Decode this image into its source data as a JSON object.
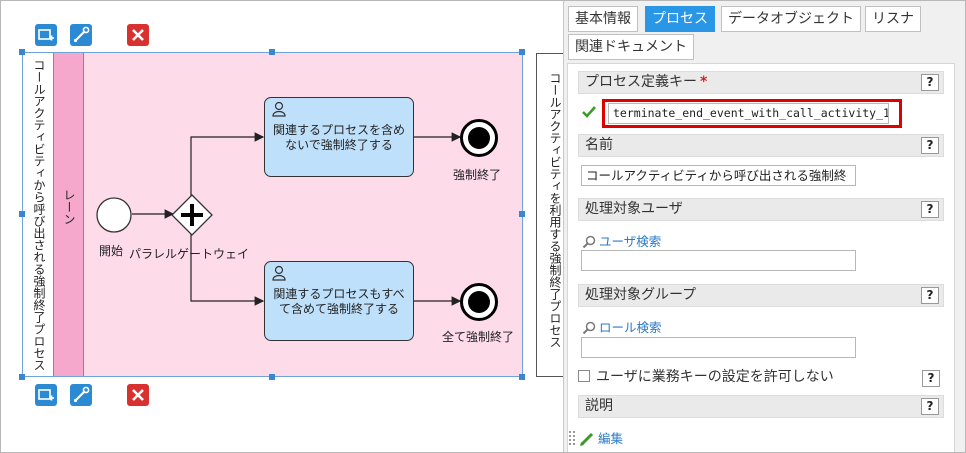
{
  "canvas": {
    "pool_label": "コールアクティビティから呼び出される強制終了プロセス",
    "lane_label": "レーン",
    "start_label": "開始",
    "gateway_label": "パラレルゲートウェイ",
    "task1_label": "関連するプロセスを含めないで強制終了する",
    "task2_label": "関連するプロセスもすべて含めて強制終了する",
    "end1_label": "強制終了",
    "end2_label": "全て強制終了",
    "other_pool_label": "コールアクティビティを利用する強制終了プロセス"
  },
  "tabs": [
    {
      "label": "基本情報",
      "active": false
    },
    {
      "label": "プロセス",
      "active": true
    },
    {
      "label": "データオブジェクト",
      "active": false
    },
    {
      "label": "リスナ",
      "active": false
    },
    {
      "label": "関連ドキュメント",
      "active": false
    }
  ],
  "properties": {
    "process_key": {
      "label": "プロセス定義キー",
      "required_mark": "*",
      "value": "terminate_end_event_with_call_activity_1"
    },
    "name": {
      "label": "名前",
      "value": "コールアクティビティから呼び出される強制終"
    },
    "assignee_user": {
      "label": "処理対象ユーザ",
      "link": "ユーザ検索",
      "value": ""
    },
    "assignee_group": {
      "label": "処理対象グループ",
      "link": "ロール検索",
      "value": ""
    },
    "business_key": {
      "label": "ユーザに業務キーの設定を許可しない",
      "checked": false
    },
    "description": {
      "label": "説明",
      "link": "編集"
    },
    "help_label": "?"
  },
  "colors": {
    "accent": "#2a96e6",
    "lane": "#fddbe8",
    "lane_header": "#f5a8cc",
    "task": "#bfe0fa",
    "highlight": "#e00000"
  }
}
